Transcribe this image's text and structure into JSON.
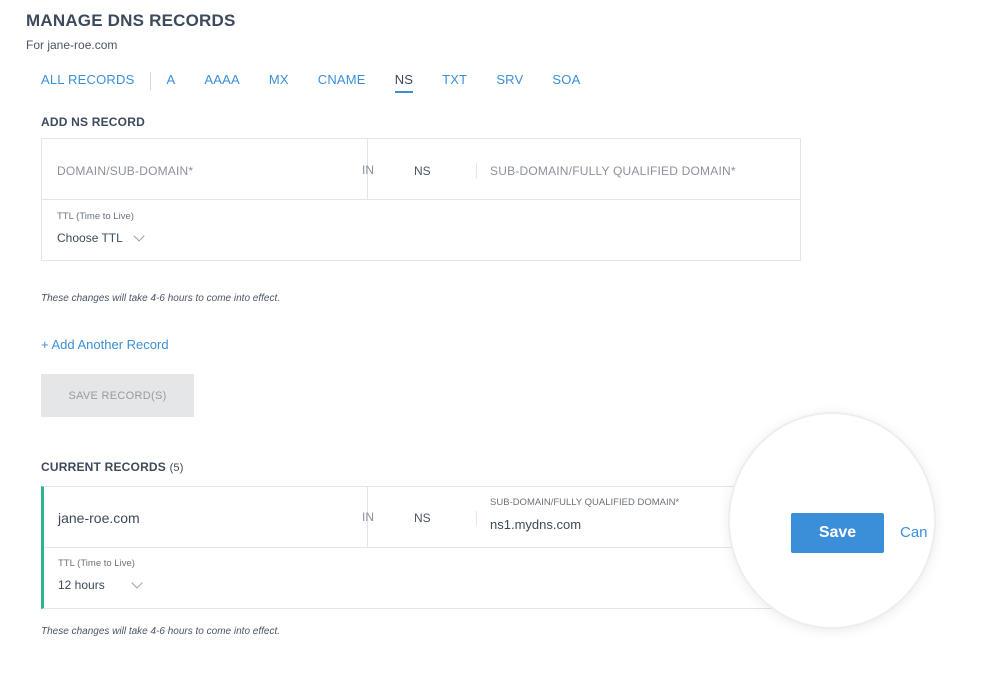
{
  "header": {
    "title": "MANAGE DNS RECORDS",
    "subtitle": "For jane-roe.com"
  },
  "tabs": [
    {
      "label": "ALL RECORDS",
      "active": false
    },
    {
      "label": "A",
      "active": false
    },
    {
      "label": "AAAA",
      "active": false
    },
    {
      "label": "MX",
      "active": false
    },
    {
      "label": "CNAME",
      "active": false
    },
    {
      "label": "NS",
      "active": true
    },
    {
      "label": "TXT",
      "active": false
    },
    {
      "label": "SRV",
      "active": false
    },
    {
      "label": "SOA",
      "active": false
    }
  ],
  "add_section": {
    "title": "ADD NS RECORD",
    "domain_placeholder": "DOMAIN/SUB-DOMAIN*",
    "in_label": "IN",
    "type_label": "NS",
    "target_placeholder": "SUB-DOMAIN/FULLY QUALIFIED DOMAIN*",
    "ttl_label": "TTL (Time to Live)",
    "ttl_value": "Choose TTL",
    "note": "These changes will take 4-6 hours to come into effect.",
    "add_another": "+ Add Another Record",
    "save_records": "SAVE RECORD(S)"
  },
  "current_section": {
    "title": "CURRENT RECORDS",
    "count": "(5)",
    "record": {
      "domain": "jane-roe.com",
      "in_label": "IN",
      "type_label": "NS",
      "target_label": "SUB-DOMAIN/FULLY QUALIFIED DOMAIN*",
      "target_value": "ns1.mydns.com",
      "ttl_label": "TTL (Time to Live)",
      "ttl_value": "12 hours"
    },
    "note": "These changes will take 4-6 hours to come into effect.",
    "save_button": "Save",
    "cancel_button": "Cancel"
  },
  "colors": {
    "accent": "#3b8fd8",
    "active_record_border": "#29b38f",
    "disabled_button": "#e4e6e8"
  }
}
